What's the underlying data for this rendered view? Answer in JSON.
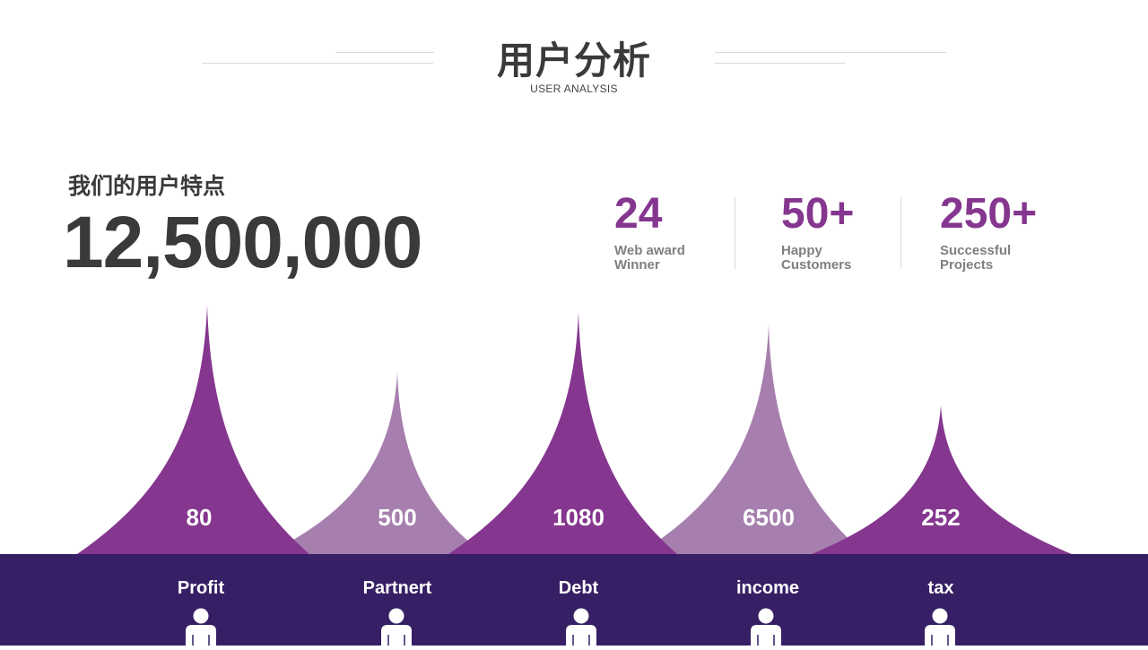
{
  "header": {
    "title": "用户分析",
    "subtitle": "USER ANALYSIS"
  },
  "feature": {
    "label": "我们的用户特点",
    "total": "12,500,000"
  },
  "stats": [
    {
      "value": "24",
      "label": "Web award Winner"
    },
    {
      "value": "50+",
      "label": "Happy Customers"
    },
    {
      "value": "250+",
      "label": "Successful Projects"
    }
  ],
  "colors": {
    "dark_purple": "#85368f",
    "light_purple": "#a67fae",
    "footer_bg": "#371f65",
    "text_dark": "#3a3a3a"
  },
  "chart_data": {
    "type": "area",
    "categories": [
      "Profit",
      "Partnert",
      "Debt",
      "income",
      "tax"
    ],
    "values": [
      80,
      500,
      1080,
      6500,
      252
    ],
    "value_labels": [
      "80",
      "500",
      "1080",
      "6500",
      "252"
    ],
    "icons": [
      "person-icon",
      "person-icon",
      "person-icon",
      "person-icon",
      "person-icon"
    ]
  }
}
